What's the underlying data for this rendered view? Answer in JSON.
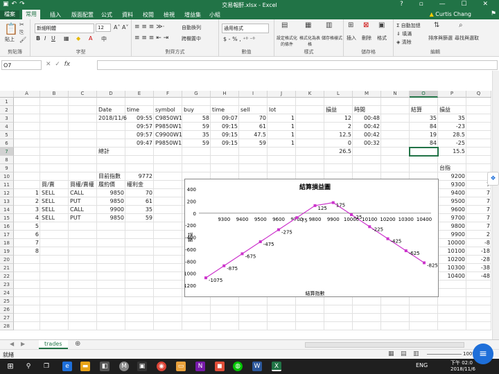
{
  "window": {
    "title": "交易報酐.xlsx - Excel",
    "help": "?",
    "controls": [
      "▫",
      "—",
      "☐",
      "✕"
    ]
  },
  "ribbon_tabs": [
    "檔案",
    "常用",
    "插入",
    "版面配置",
    "公式",
    "資料",
    "校閱",
    "檢視",
    "增益集",
    "小組"
  ],
  "user": "Curtis Chang",
  "ribbon": {
    "paste": "貼上",
    "font_name": "新細明體",
    "font_size": "12",
    "wrap": "自動換列",
    "merge": "跨欄置中",
    "number_format": "通用格式",
    "cond_format": "設定格式化的條件",
    "as_table": "格式化為表格",
    "cell_style": "儲存格樣式",
    "insert": "插入",
    "delete": "刪除",
    "format": "格式",
    "autosum": "自動加總",
    "fill": "填滿",
    "clear": "清除",
    "sort": "排序與篩選",
    "find": "尋找與選取",
    "groups": [
      "剪貼簿",
      "字型",
      "對齊方式",
      "數值",
      "樣式",
      "儲存格",
      "編輯"
    ]
  },
  "formula_bar": {
    "name_box": "O7",
    "fx": "fx",
    "content": ""
  },
  "columns": [
    "A",
    "B",
    "C",
    "D",
    "E",
    "F",
    "G",
    "H",
    "I",
    "J",
    "K",
    "L",
    "M",
    "N",
    "O",
    "P",
    "Q"
  ],
  "rows": [
    "1",
    "2",
    "3",
    "4",
    "5",
    "6",
    "7",
    "8",
    "9",
    "10",
    "11",
    "12",
    "13",
    "14",
    "15",
    "16",
    "17",
    "18",
    "19",
    "20",
    "21",
    "22",
    "23",
    "24",
    "25",
    "26",
    "27",
    "28"
  ],
  "cells": {
    "D2": "Date",
    "E2": "time",
    "F2": "symbol",
    "G2": "buy",
    "H2": "time",
    "I2": "sell",
    "J2": "lot",
    "L2": "損益",
    "M2": "時間",
    "O2": "結算",
    "P2": "損益",
    "D3": "2018/11/6",
    "E3": "09:55",
    "F3": "C9850W1",
    "G3": "58",
    "H3": "09:07",
    "I3": "70",
    "J3": "1",
    "L3": "12",
    "M3": "00:48",
    "O3": "35",
    "P3": "35",
    "E4": "09:57",
    "F4": "P9850W1",
    "G4": "59",
    "H4": "09:15",
    "I4": "61",
    "J4": "1",
    "L4": "2",
    "M4": "00:42",
    "O4": "84",
    "P4": "-23",
    "E5": "09:57",
    "F5": "C9900W1",
    "G5": "35",
    "H5": "09:15",
    "I5": "47.5",
    "J5": "1",
    "L5": "12.5",
    "M5": "00:42",
    "O5": "19",
    "P5": "28.5",
    "E6": "09:47",
    "F6": "P9850W1",
    "G6": "59",
    "H6": "09:15",
    "I6": "59",
    "J6": "1",
    "L6": "0",
    "M6": "00:32",
    "O6": "84",
    "P6": "-25",
    "D7": "總計",
    "L7": "26.5",
    "P7": "15.5",
    "P9": "台指",
    "D10": "目前指數",
    "E10": "9772",
    "P10": "9200",
    "B11": "買/賣",
    "C11": "買權/賣權",
    "D11": "履約價",
    "E11": "權利金",
    "P11": "9300",
    "Q11": "7",
    "A12": "1",
    "B12": "SELL",
    "C12": "CALL",
    "D12": "9850",
    "E12": "70",
    "P12": "9400",
    "Q12": "7",
    "A13": "2",
    "B13": "SELL",
    "C13": "PUT",
    "D13": "9850",
    "E13": "61",
    "P13": "9500",
    "Q13": "7",
    "A14": "3",
    "B14": "SELL",
    "C14": "CALL",
    "D14": "9900",
    "E14": "35",
    "P14": "9600",
    "Q14": "7",
    "A15": "4",
    "B15": "SELL",
    "C15": "PUT",
    "D15": "9850",
    "E15": "59",
    "P15": "9700",
    "Q15": "7",
    "A16": "5",
    "P16": "9800",
    "Q16": "7",
    "A17": "6",
    "P17": "9900",
    "Q17": "2",
    "A18": "7",
    "P18": "10000",
    "Q18": "-8",
    "A19": "8",
    "P19": "10100",
    "Q19": "-18",
    "P20": "10200",
    "Q20": "-28",
    "P21": "10300",
    "Q21": "-38",
    "P22": "10400",
    "Q22": "-48"
  },
  "chart_data": {
    "type": "line",
    "title": "結算損益圖",
    "xlabel": "結算指數",
    "ylabel": "損益",
    "x": [
      9200,
      9300,
      9400,
      9500,
      9600,
      9700,
      9800,
      9900,
      10000,
      10100,
      10200,
      10300,
      10400
    ],
    "values": [
      -1075,
      -875,
      -675,
      -475,
      -275,
      -75,
      125,
      175,
      -25,
      -225,
      -425,
      -625,
      -825
    ],
    "x_tick_labels": [
      "9300",
      "9400",
      "9500",
      "9600",
      "9700",
      "9800",
      "9900",
      "10000",
      "10100",
      "10200",
      "10300",
      "10400"
    ],
    "ylim": [
      -1200,
      400
    ],
    "y_ticks": [
      400,
      200,
      0,
      -200,
      -400,
      -600,
      -800,
      -1000,
      -1200
    ],
    "color": "#cc33cc",
    "data_labels": true,
    "grid": false
  },
  "sheet_tabs": [
    {
      "label": "trades"
    }
  ],
  "add_sheet": "⊕",
  "status": {
    "ready": "就緒",
    "zoom": "100%"
  },
  "taskbar": {
    "time": "下午 02:0",
    "date": "2018/11/6",
    "lang": "ENG"
  }
}
